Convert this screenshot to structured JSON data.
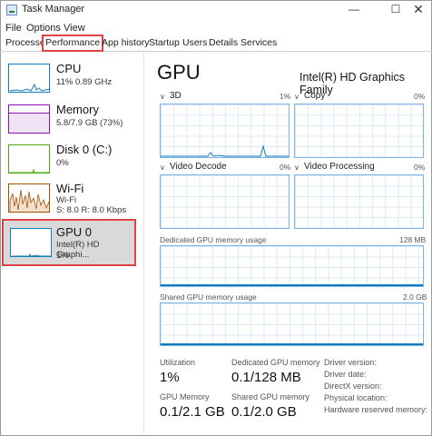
{
  "window": {
    "title": "Task Manager"
  },
  "menu": [
    "File",
    "Options",
    "View"
  ],
  "tabs": [
    "Processes",
    "Performance",
    "App history",
    "Startup",
    "Users",
    "Details",
    "Services"
  ],
  "sidebar": {
    "items": [
      {
        "name": "CPU",
        "sub1": "11% 0.89 GHz",
        "sub2": "",
        "color": "#117dbb"
      },
      {
        "name": "Memory",
        "sub1": "5.8/7.9 GB (73%)",
        "sub2": "",
        "color": "#8b12ae"
      },
      {
        "name": "Disk 0 (C:)",
        "sub1": "0%",
        "sub2": "",
        "color": "#4da60c"
      },
      {
        "name": "Wi-Fi",
        "sub1": "Wi-Fi",
        "sub2": "S: 8.0 R: 8.0 Kbps",
        "color": "#a74f01"
      },
      {
        "name": "GPU 0",
        "sub1": "Intel(R) HD Graphi...",
        "sub2": "1%",
        "color": "#117dbb"
      }
    ]
  },
  "main": {
    "title": "GPU",
    "model": "Intel(R) HD Graphics Family",
    "engines": [
      {
        "label": "3D",
        "pct": "1%"
      },
      {
        "label": "Copy",
        "pct": "0%"
      },
      {
        "label": "Video Decode",
        "pct": "0%"
      },
      {
        "label": "Video Processing",
        "pct": "0%"
      }
    ],
    "dedicated": {
      "label": "Dedicated GPU memory usage",
      "max": "128 MB"
    },
    "shared": {
      "label": "Shared GPU memory usage",
      "max": "2.0 GB"
    },
    "stats": {
      "utilization_label": "Utilization",
      "utilization": "1%",
      "dedicated_label": "Dedicated GPU memory",
      "dedicated": "0.1/128 MB",
      "gpu_mem_label": "GPU Memory",
      "gpu_mem": "0.1/2.1 GB",
      "shared_label": "Shared GPU memory",
      "shared": "0.1/2.0 GB"
    },
    "info": [
      "Driver version:",
      "Driver date:",
      "DirectX version:",
      "Physical location:",
      "Hardware reserved memory:"
    ]
  },
  "icons": {
    "minimize": "minimize-icon",
    "maximize": "maximize-icon",
    "close": "close-icon"
  }
}
